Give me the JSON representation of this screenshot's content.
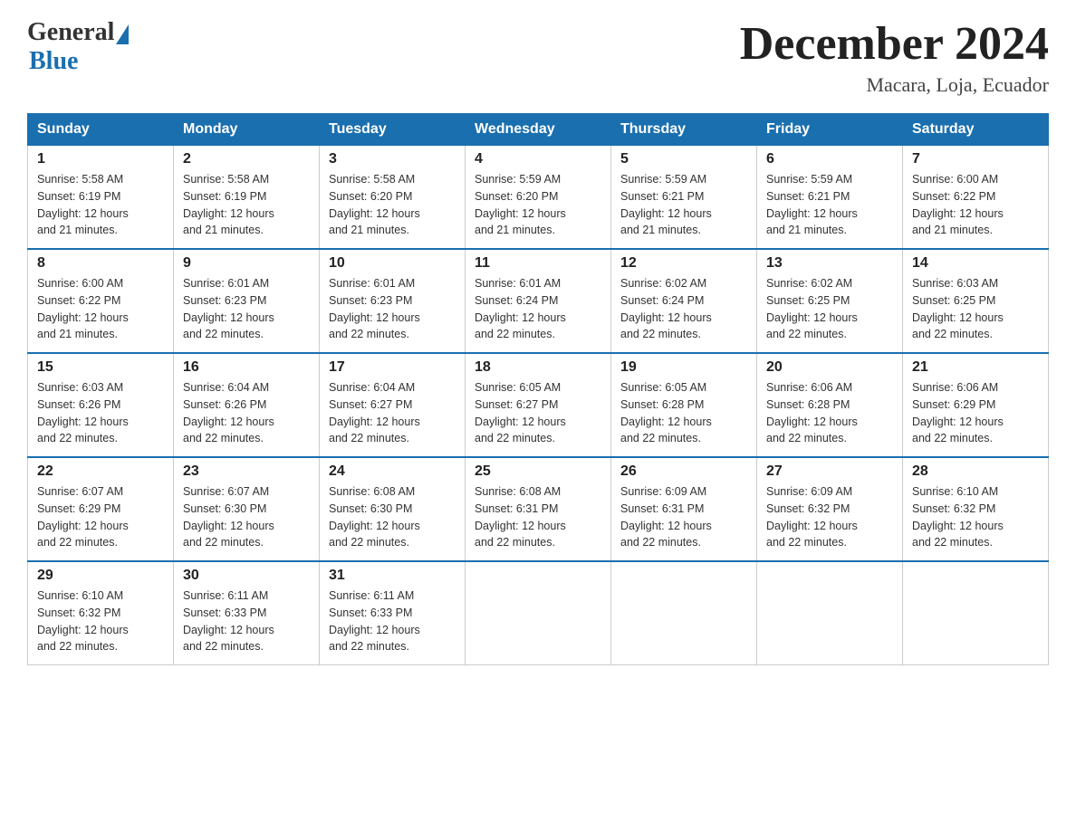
{
  "header": {
    "logo_general": "General",
    "logo_blue": "Blue",
    "month_title": "December 2024",
    "location": "Macara, Loja, Ecuador"
  },
  "days_of_week": [
    "Sunday",
    "Monday",
    "Tuesday",
    "Wednesday",
    "Thursday",
    "Friday",
    "Saturday"
  ],
  "weeks": [
    [
      {
        "day": "1",
        "sunrise": "5:58 AM",
        "sunset": "6:19 PM",
        "daylight": "12 hours and 21 minutes."
      },
      {
        "day": "2",
        "sunrise": "5:58 AM",
        "sunset": "6:19 PM",
        "daylight": "12 hours and 21 minutes."
      },
      {
        "day": "3",
        "sunrise": "5:58 AM",
        "sunset": "6:20 PM",
        "daylight": "12 hours and 21 minutes."
      },
      {
        "day": "4",
        "sunrise": "5:59 AM",
        "sunset": "6:20 PM",
        "daylight": "12 hours and 21 minutes."
      },
      {
        "day": "5",
        "sunrise": "5:59 AM",
        "sunset": "6:21 PM",
        "daylight": "12 hours and 21 minutes."
      },
      {
        "day": "6",
        "sunrise": "5:59 AM",
        "sunset": "6:21 PM",
        "daylight": "12 hours and 21 minutes."
      },
      {
        "day": "7",
        "sunrise": "6:00 AM",
        "sunset": "6:22 PM",
        "daylight": "12 hours and 21 minutes."
      }
    ],
    [
      {
        "day": "8",
        "sunrise": "6:00 AM",
        "sunset": "6:22 PM",
        "daylight": "12 hours and 21 minutes."
      },
      {
        "day": "9",
        "sunrise": "6:01 AM",
        "sunset": "6:23 PM",
        "daylight": "12 hours and 22 minutes."
      },
      {
        "day": "10",
        "sunrise": "6:01 AM",
        "sunset": "6:23 PM",
        "daylight": "12 hours and 22 minutes."
      },
      {
        "day": "11",
        "sunrise": "6:01 AM",
        "sunset": "6:24 PM",
        "daylight": "12 hours and 22 minutes."
      },
      {
        "day": "12",
        "sunrise": "6:02 AM",
        "sunset": "6:24 PM",
        "daylight": "12 hours and 22 minutes."
      },
      {
        "day": "13",
        "sunrise": "6:02 AM",
        "sunset": "6:25 PM",
        "daylight": "12 hours and 22 minutes."
      },
      {
        "day": "14",
        "sunrise": "6:03 AM",
        "sunset": "6:25 PM",
        "daylight": "12 hours and 22 minutes."
      }
    ],
    [
      {
        "day": "15",
        "sunrise": "6:03 AM",
        "sunset": "6:26 PM",
        "daylight": "12 hours and 22 minutes."
      },
      {
        "day": "16",
        "sunrise": "6:04 AM",
        "sunset": "6:26 PM",
        "daylight": "12 hours and 22 minutes."
      },
      {
        "day": "17",
        "sunrise": "6:04 AM",
        "sunset": "6:27 PM",
        "daylight": "12 hours and 22 minutes."
      },
      {
        "day": "18",
        "sunrise": "6:05 AM",
        "sunset": "6:27 PM",
        "daylight": "12 hours and 22 minutes."
      },
      {
        "day": "19",
        "sunrise": "6:05 AM",
        "sunset": "6:28 PM",
        "daylight": "12 hours and 22 minutes."
      },
      {
        "day": "20",
        "sunrise": "6:06 AM",
        "sunset": "6:28 PM",
        "daylight": "12 hours and 22 minutes."
      },
      {
        "day": "21",
        "sunrise": "6:06 AM",
        "sunset": "6:29 PM",
        "daylight": "12 hours and 22 minutes."
      }
    ],
    [
      {
        "day": "22",
        "sunrise": "6:07 AM",
        "sunset": "6:29 PM",
        "daylight": "12 hours and 22 minutes."
      },
      {
        "day": "23",
        "sunrise": "6:07 AM",
        "sunset": "6:30 PM",
        "daylight": "12 hours and 22 minutes."
      },
      {
        "day": "24",
        "sunrise": "6:08 AM",
        "sunset": "6:30 PM",
        "daylight": "12 hours and 22 minutes."
      },
      {
        "day": "25",
        "sunrise": "6:08 AM",
        "sunset": "6:31 PM",
        "daylight": "12 hours and 22 minutes."
      },
      {
        "day": "26",
        "sunrise": "6:09 AM",
        "sunset": "6:31 PM",
        "daylight": "12 hours and 22 minutes."
      },
      {
        "day": "27",
        "sunrise": "6:09 AM",
        "sunset": "6:32 PM",
        "daylight": "12 hours and 22 minutes."
      },
      {
        "day": "28",
        "sunrise": "6:10 AM",
        "sunset": "6:32 PM",
        "daylight": "12 hours and 22 minutes."
      }
    ],
    [
      {
        "day": "29",
        "sunrise": "6:10 AM",
        "sunset": "6:32 PM",
        "daylight": "12 hours and 22 minutes."
      },
      {
        "day": "30",
        "sunrise": "6:11 AM",
        "sunset": "6:33 PM",
        "daylight": "12 hours and 22 minutes."
      },
      {
        "day": "31",
        "sunrise": "6:11 AM",
        "sunset": "6:33 PM",
        "daylight": "12 hours and 22 minutes."
      },
      null,
      null,
      null,
      null
    ]
  ],
  "labels": {
    "sunrise": "Sunrise:",
    "sunset": "Sunset:",
    "daylight": "Daylight:"
  }
}
